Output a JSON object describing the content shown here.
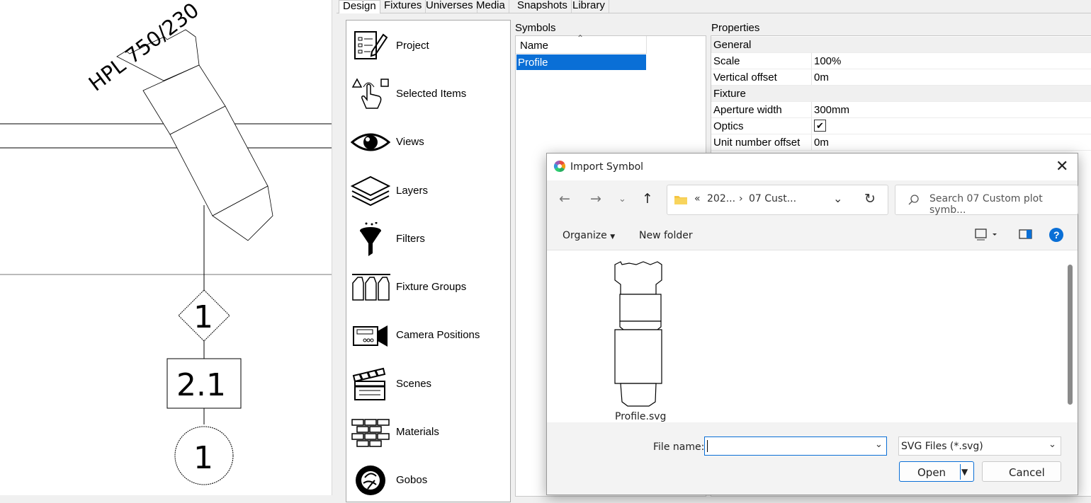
{
  "canvas": {
    "fixture_label": "HPL 750/230",
    "unit_number_diamond": "1",
    "channel_box": "2.1",
    "circle_number": "1"
  },
  "tabs": [
    {
      "label": "Design",
      "active": true
    },
    {
      "label": "Fixtures",
      "active": false
    },
    {
      "label": "Universes",
      "active": false
    },
    {
      "label": "Media",
      "active": false
    },
    {
      "label": "Snapshots",
      "active": false
    },
    {
      "label": "Library",
      "active": false
    }
  ],
  "nav": {
    "items": [
      {
        "label": "Project",
        "icon": "project-icon"
      },
      {
        "label": "Selected Items",
        "icon": "selected-items-icon"
      },
      {
        "label": "Views",
        "icon": "eye-icon"
      },
      {
        "label": "Layers",
        "icon": "layers-icon"
      },
      {
        "label": "Filters",
        "icon": "funnel-icon"
      },
      {
        "label": "Fixture Groups",
        "icon": "fixture-groups-icon"
      },
      {
        "label": "Camera Positions",
        "icon": "camera-icon"
      },
      {
        "label": "Scenes",
        "icon": "clapperboard-icon"
      },
      {
        "label": "Materials",
        "icon": "bricks-icon"
      },
      {
        "label": "Gobos",
        "icon": "gobo-icon"
      }
    ]
  },
  "symbols": {
    "title": "Symbols",
    "column": "Name",
    "rows": [
      "Profile"
    ],
    "selected": "Profile"
  },
  "properties": {
    "title": "Properties",
    "rows": [
      {
        "key": "General",
        "category": true
      },
      {
        "key": "Scale",
        "value": "100%"
      },
      {
        "key": "Vertical offset",
        "value": "0m"
      },
      {
        "key": "Fixture",
        "category": true
      },
      {
        "key": "Aperture width",
        "value": "300mm"
      },
      {
        "key": "Optics",
        "checked": true
      },
      {
        "key": "Unit number offset",
        "value": "0m"
      }
    ]
  },
  "dialog": {
    "title": "Import Symbol",
    "address": {
      "overflow": "«",
      "crumb1": "202...",
      "sep": "›",
      "crumb2": "07 Cust..."
    },
    "search_placeholder": "Search 07 Custom plot symb...",
    "organize": "Organize",
    "new_folder": "New folder",
    "files": [
      {
        "name": "Profile.svg"
      }
    ],
    "file_name_label": "File name:",
    "file_name_value": "",
    "file_type": "SVG Files (*.svg)",
    "open_label": "Open",
    "cancel_label": "Cancel",
    "accent_color": "#0a6fd6"
  }
}
